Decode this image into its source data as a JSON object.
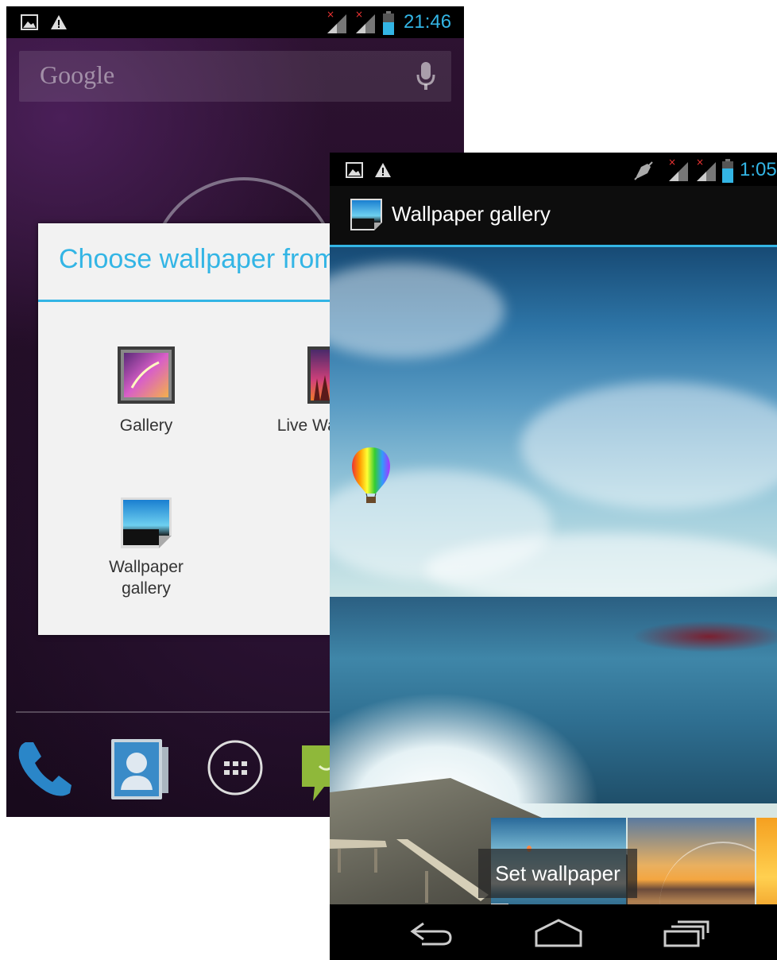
{
  "screen1": {
    "status_bar": {
      "time": "21:46",
      "left_icons": [
        "image-icon",
        "warning-icon"
      ],
      "right_icons": [
        "signal-icon",
        "signal-icon",
        "battery-icon"
      ]
    },
    "search": {
      "logo_text": "Google",
      "icon": "mic-icon"
    },
    "dialog": {
      "title": "Choose wallpaper from",
      "items": [
        {
          "label": "Gallery",
          "icon": "gallery-icon"
        },
        {
          "label": "Live Wallpapers",
          "icon": "live-wallpapers-icon"
        },
        {
          "label_line1": "Wallpaper",
          "label_line2": "gallery",
          "icon": "wallpaper-gallery-icon"
        }
      ]
    },
    "dock": [
      "phone-icon",
      "contacts-icon",
      "app-drawer-icon",
      "messaging-icon"
    ]
  },
  "screen2": {
    "status_bar": {
      "time": "1:05",
      "left_icons": [
        "image-icon",
        "warning-icon"
      ],
      "right_icons": [
        "mute-icon",
        "signal-icon",
        "signal-icon",
        "battery-icon"
      ]
    },
    "action_bar": {
      "title": "Wallpaper gallery",
      "icon": "wallpaper-gallery-icon"
    },
    "thumbnails": [
      "ocean-balloon-thumbnail",
      "sunset-lake-thumbnail",
      "orange-thumbnail"
    ],
    "set_wallpaper_label": "Set wallpaper",
    "nav": [
      "back-icon",
      "home-icon",
      "recent-apps-icon"
    ]
  },
  "colors": {
    "accent": "#33b5e5",
    "dialog_bg": "#f2f2f2"
  }
}
